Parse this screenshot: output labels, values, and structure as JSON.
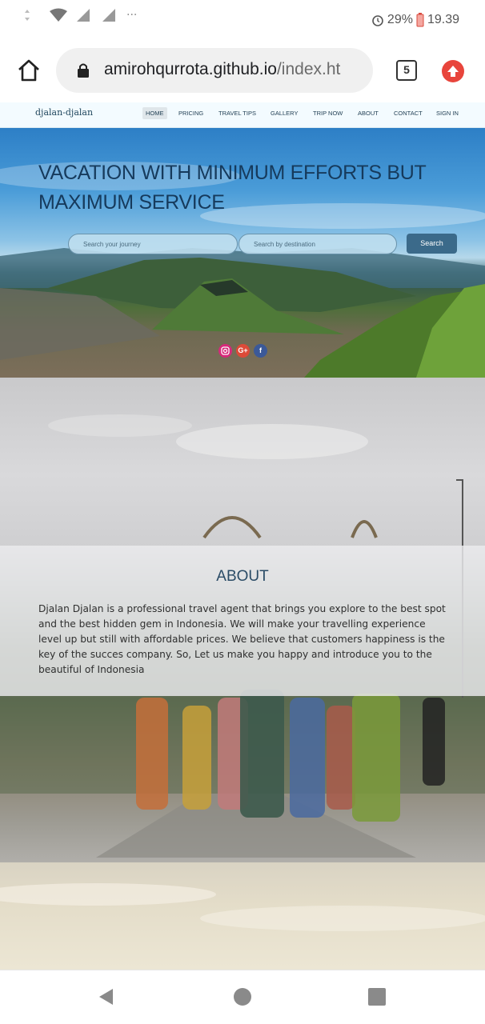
{
  "status_bar": {
    "battery": "29%",
    "time": "19.39"
  },
  "browser": {
    "url_main": "amirohqurrota.github.io",
    "url_rest": "/index.ht",
    "tab_count": "5"
  },
  "site": {
    "logo": "djalan-djalan",
    "nav": [
      "HOME",
      "PRICING",
      "TRAVEL TIPS",
      "GALLERY",
      "TRIP NOW",
      "ABOUT",
      "CONTACT",
      "SIGN IN"
    ],
    "active_nav": "HOME"
  },
  "hero": {
    "title": "VACATION WITH MINIMUM EFFORTS BUT MAXIMUM SERVICE",
    "search_journey_placeholder": "Search your journey",
    "search_destination_placeholder": "Search by destination",
    "search_button": "Search",
    "social": {
      "instagram_color": "#d6297a",
      "google_plus_color": "#dc4a38",
      "google_plus_label": "G+",
      "facebook_color": "#3b5998",
      "facebook_label": "f"
    }
  },
  "about": {
    "title": "ABOUT",
    "text": "Djalan Djalan is a professional travel agent that brings you explore to the best spot and the best hidden gem in Indonesia. We will make your travelling experience level up but still with affordable prices. We believe that customers happiness is the key of the succes company. So, Let us make you happy and introduce you to the beautiful of Indonesia"
  }
}
